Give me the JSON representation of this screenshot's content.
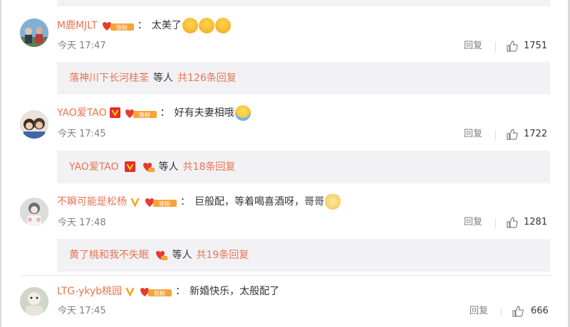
{
  "comments": [
    {
      "username": "M鹿MJLT",
      "fan_badge": "铁粉",
      "colon": "：",
      "text": "太美了",
      "emojis": [
        "blush-face-emoji",
        "blush-face-emoji",
        "blush-face-emoji"
      ],
      "time": "今天 17:47",
      "reply_label": "回复",
      "likes": "1751",
      "reply_preview": {
        "name": "落神川下长河桂荃",
        "middle": "等人",
        "count_label": "共126条回复"
      }
    },
    {
      "username": "YAO爱TAO",
      "fan_badge": "铁粉",
      "colon": "：",
      "text": "好有夫妻相哦",
      "emojis": [
        "laugh-cry-emoji"
      ],
      "time": "今天 17:45",
      "reply_label": "回复",
      "likes": "1722",
      "reply_preview": {
        "name": "YAO爱TAO",
        "middle": "等人",
        "count_label": "共18条回复"
      }
    },
    {
      "username": "不瞬可能是松杨",
      "fan_badge": "铁粉",
      "colon": "：",
      "text": "巨般配，等着喝喜酒呀，哥哥",
      "emojis": [
        "cat-face-emoji"
      ],
      "time": "今天 17:48",
      "reply_label": "回复",
      "likes": "1281",
      "reply_preview": {
        "name": "黄了桃和我不失眠",
        "middle": "等人",
        "count_label": "共19条回复"
      }
    },
    {
      "username": "LTG-ykyb桃园",
      "fan_badge": "铁粉",
      "colon": "：",
      "text": "新婚快乐，太般配了",
      "time": "今天 17:45",
      "reply_label": "回复",
      "likes": "666"
    }
  ],
  "colors": {
    "username": "#eb7350",
    "text": "#333333",
    "meta": "#808080",
    "reply_bg": "#f2f2f5",
    "vip_red": "#e32d2d",
    "vip_yellow": "#f5a623"
  }
}
